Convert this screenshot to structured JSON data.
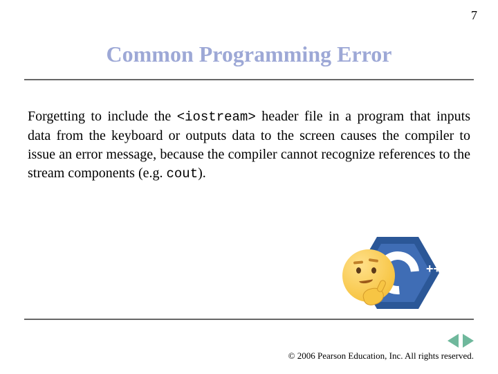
{
  "page_number": "7",
  "title": "Common Programming Error",
  "body": {
    "part1": "Forgetting to include the ",
    "code1": "<iostream>",
    "part2": " header file in a program that inputs data from the keyboard or outputs data to the screen causes the compiler to issue an error message, because the compiler cannot recognize references to the stream components (e.g. ",
    "code2": "cout",
    "part3": ")."
  },
  "logo": {
    "plus_plus": "++"
  },
  "copyright": "© 2006 Pearson Education, Inc.  All rights reserved."
}
